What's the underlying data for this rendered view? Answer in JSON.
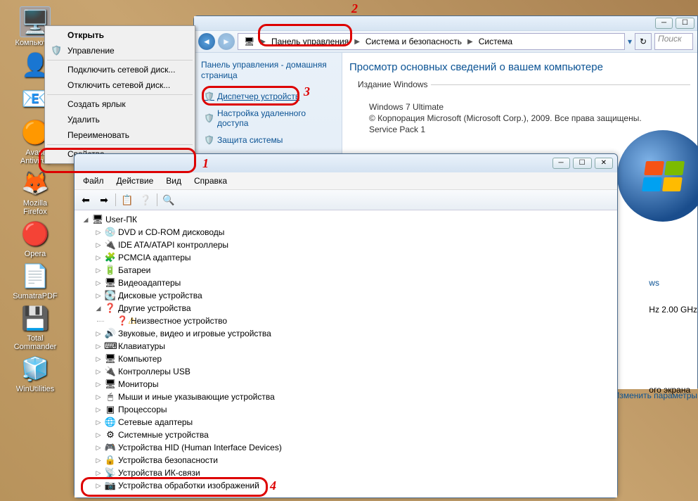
{
  "desktop_icons": [
    {
      "label": "Компьютер",
      "glyph": "🖥️"
    },
    {
      "label": "",
      "glyph": "👤"
    },
    {
      "label": "",
      "glyph": "📧"
    },
    {
      "label": "Avast\nAntivirus",
      "glyph": "🟠"
    },
    {
      "label": "Mozilla\nFirefox",
      "glyph": "🦊"
    },
    {
      "label": "Opera",
      "glyph": "🔴"
    },
    {
      "label": "SumatraPDF",
      "glyph": "📄"
    },
    {
      "label": "Total\nCommander",
      "glyph": "💾"
    },
    {
      "label": "WinUtilities",
      "glyph": "🧊"
    }
  ],
  "context_menu": {
    "items": [
      {
        "label": "Открыть",
        "bold": true
      },
      {
        "label": "Управление",
        "shield": true
      },
      {
        "sep": true
      },
      {
        "label": "Подключить сетевой диск..."
      },
      {
        "label": "Отключить сетевой диск..."
      },
      {
        "sep": true
      },
      {
        "label": "Создать ярлык"
      },
      {
        "label": "Удалить"
      },
      {
        "label": "Переименовать"
      },
      {
        "sep": true
      },
      {
        "label": "Свойства"
      }
    ]
  },
  "annotations": {
    "n1": "1",
    "n2": "2",
    "n3": "3",
    "n4": "4"
  },
  "controlpanel": {
    "breadcrumb": [
      "Панель управления",
      "Система и безопасность",
      "Система"
    ],
    "search_placeholder": "Поиск ...",
    "sidebar": {
      "home": "Панель управления - домашняя страница",
      "links": [
        {
          "label": "Диспетчер устройств",
          "shield": true
        },
        {
          "label": "Настройка удаленного доступа",
          "shield": true
        },
        {
          "label": "Защита системы",
          "shield": true
        }
      ]
    },
    "heading": "Просмотр основных сведений о вашем компьютере",
    "edition_label": "Издание Windows",
    "edition": "Windows 7 Ultimate",
    "copyright": "© Корпорация Microsoft (Microsoft Corp.), 2009. Все права защищены.",
    "sp": "Service Pack 1",
    "peek_right": [
      "ws",
      "Hz  2.00 GHz",
      "ого экрана"
    ],
    "change_params": "Изменить параметры"
  },
  "devmgr": {
    "menu": [
      "Файл",
      "Действие",
      "Вид",
      "Справка"
    ],
    "root": "User-ПК",
    "nodes": [
      {
        "label": "DVD и CD-ROM дисководы",
        "glyph": "💿"
      },
      {
        "label": "IDE ATA/ATAPI контроллеры",
        "glyph": "🔌"
      },
      {
        "label": "PCMCIA адаптеры",
        "glyph": "🧩"
      },
      {
        "label": "Батареи",
        "glyph": "🔋"
      },
      {
        "label": "Видеоадаптеры",
        "glyph": "🖥"
      },
      {
        "label": "Дисковые устройства",
        "glyph": "💽"
      },
      {
        "label": "Другие устройства",
        "glyph": "❓",
        "open": true,
        "children": [
          {
            "label": "Неизвестное устройство",
            "glyph": "❓",
            "warn": true
          }
        ]
      },
      {
        "label": "Звуковые, видео и игровые устройства",
        "glyph": "🔊"
      },
      {
        "label": "Клавиатуры",
        "glyph": "⌨"
      },
      {
        "label": "Компьютер",
        "glyph": "🖥"
      },
      {
        "label": "Контроллеры USB",
        "glyph": "🔌"
      },
      {
        "label": "Мониторы",
        "glyph": "🖥"
      },
      {
        "label": "Мыши и иные указывающие устройства",
        "glyph": "🖱"
      },
      {
        "label": "Процессоры",
        "glyph": "▣"
      },
      {
        "label": "Сетевые адаптеры",
        "glyph": "🌐"
      },
      {
        "label": "Системные устройства",
        "glyph": "⚙"
      },
      {
        "label": "Устройства HID (Human Interface Devices)",
        "glyph": "🎮"
      },
      {
        "label": "Устройства безопасности",
        "glyph": "🔒"
      },
      {
        "label": "Устройства ИК-связи",
        "glyph": "📡"
      },
      {
        "label": "Устройства обработки изображений",
        "glyph": "📷"
      }
    ]
  }
}
